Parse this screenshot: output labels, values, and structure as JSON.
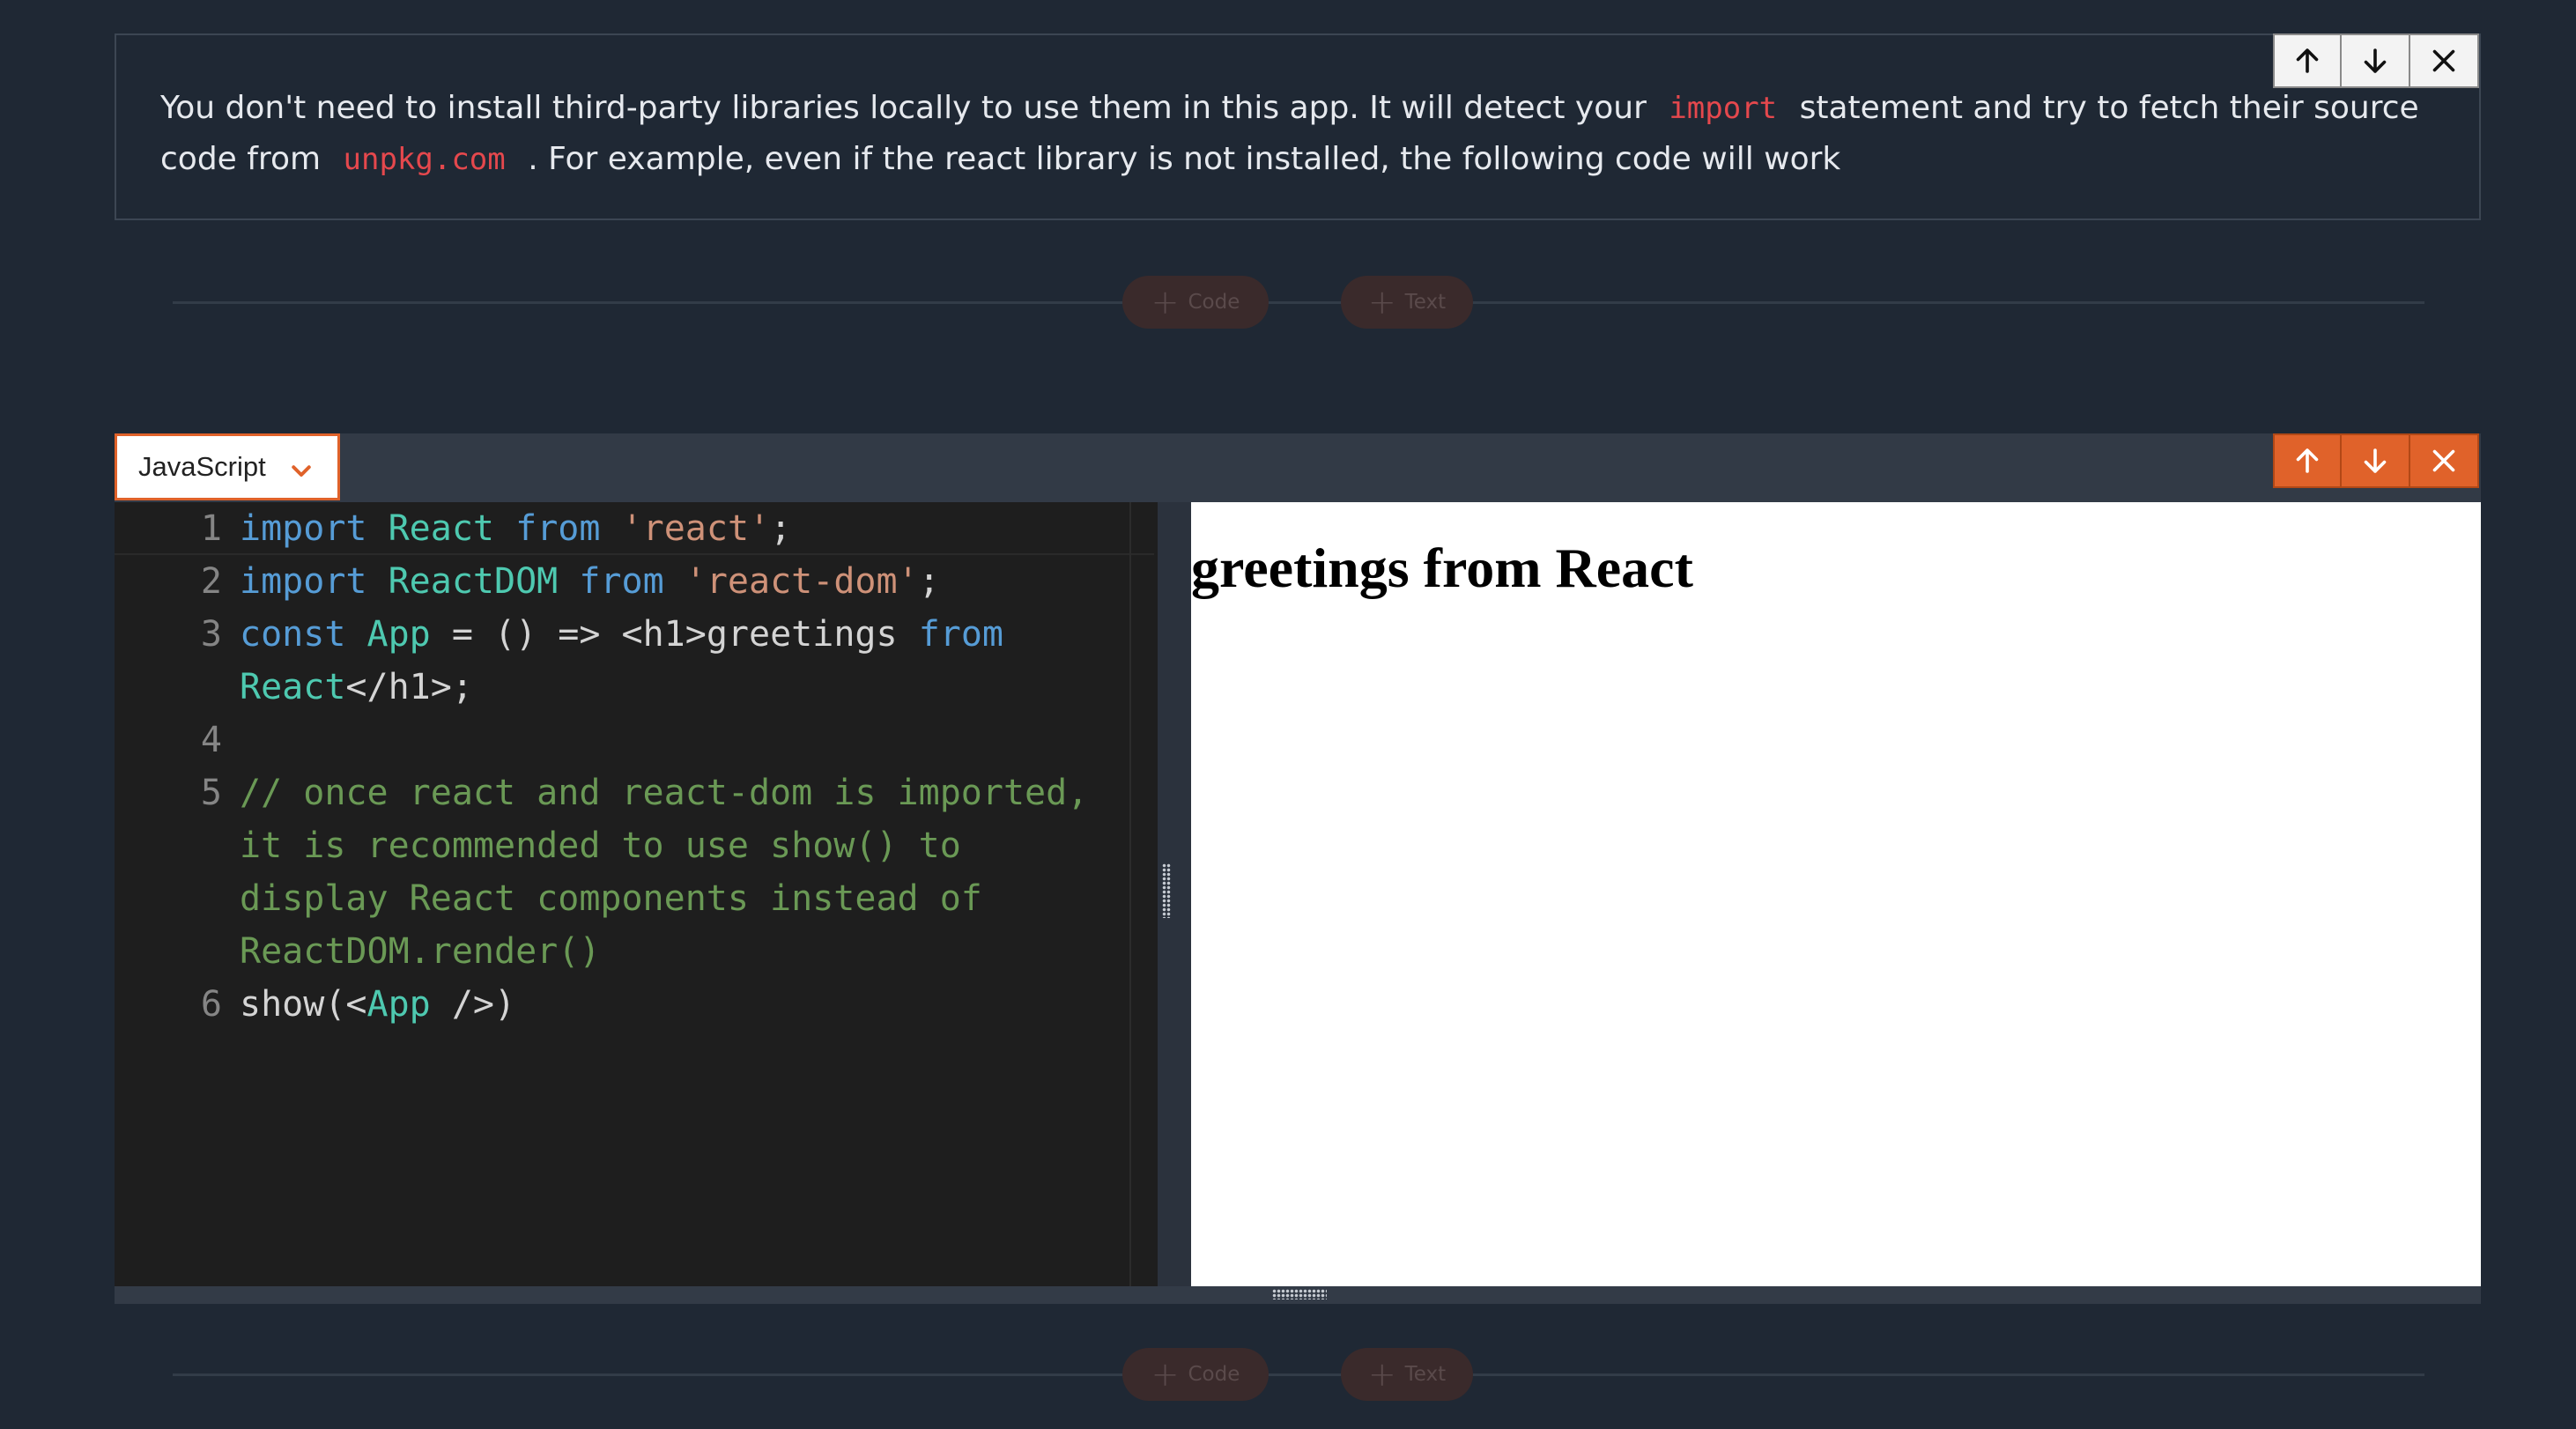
{
  "text_cell": {
    "segment_1": "You don't need to install third-party libraries locally to use them in this app. It will detect your",
    "code_1": "import",
    "segment_2": "statement and try to fetch their source code from",
    "code_2": "unpkg.com",
    "segment_3": ". For example, even if the react library is not installed, the following code will work"
  },
  "add_bar": {
    "code_label": "Code",
    "text_label": "Text"
  },
  "code_cell": {
    "language": "JavaScript",
    "line_numbers": [
      "1",
      "2",
      "3",
      "4",
      "5",
      "6"
    ],
    "tokens": {
      "l1_import": "import",
      "l1_react": "React",
      "l1_from": "from",
      "l1_str": "'react'",
      "l1_end": ";",
      "l2_import": "import",
      "l2_reactdom": "ReactDOM",
      "l2_from": "from",
      "l2_str": "'react-dom'",
      "l2_end": ";",
      "l3_const": "const",
      "l3_app": "App",
      "l3_rest": "= () => <h1>greetings",
      "l3_from": "from",
      "l3b_react": "React",
      "l3b_rest": "</h1>;",
      "l5_comment_a": "// once react and react-dom is imported,",
      "l5_comment_b": "it is recommended to use show() to",
      "l5_comment_c": "display React components instead of",
      "l5_comment_d": "ReactDOM.render()",
      "l6_show": "show(<",
      "l6_app": "App",
      "l6_rest": " />)"
    }
  },
  "preview": {
    "heading": "greetings from React"
  },
  "icons": {
    "up": "arrow-up-icon",
    "down": "arrow-down-icon",
    "close": "close-icon",
    "plus": "plus-icon",
    "chevron": "chevron-down-icon"
  },
  "colors": {
    "accent": "#e0622a",
    "background": "#1f2834",
    "inline_code": "#e5484d"
  }
}
